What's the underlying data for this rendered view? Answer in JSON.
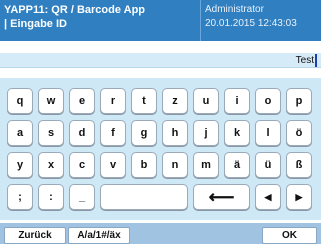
{
  "header": {
    "app_title": "YAPP11: QR / Barcode App",
    "screen_title": "| Eingabe ID",
    "user": "Administrator",
    "datetime": "20.01.2015 12:43:03"
  },
  "input": {
    "value": "Test"
  },
  "keyboard": {
    "row1": [
      "q",
      "w",
      "e",
      "r",
      "t",
      "z",
      "u",
      "i",
      "o",
      "p"
    ],
    "row2": [
      "a",
      "s",
      "d",
      "f",
      "g",
      "h",
      "j",
      "k",
      "l",
      "ö"
    ],
    "row3": [
      "y",
      "x",
      "c",
      "v",
      "b",
      "n",
      "m",
      "ä",
      "ü",
      "ß"
    ],
    "row4": {
      "semicolon": ";",
      "colon": ":",
      "underscore": "_",
      "backspace": "⟵",
      "left": "◀",
      "right": "▶"
    }
  },
  "footer": {
    "back_label": "Zurück",
    "mode_label": "A/a/1#/äx",
    "ok_label": "OK"
  },
  "colors": {
    "header": "#2f7fc1",
    "keyboard_bg": "#cfe8f6",
    "footer_bg": "#9fc3e0"
  }
}
